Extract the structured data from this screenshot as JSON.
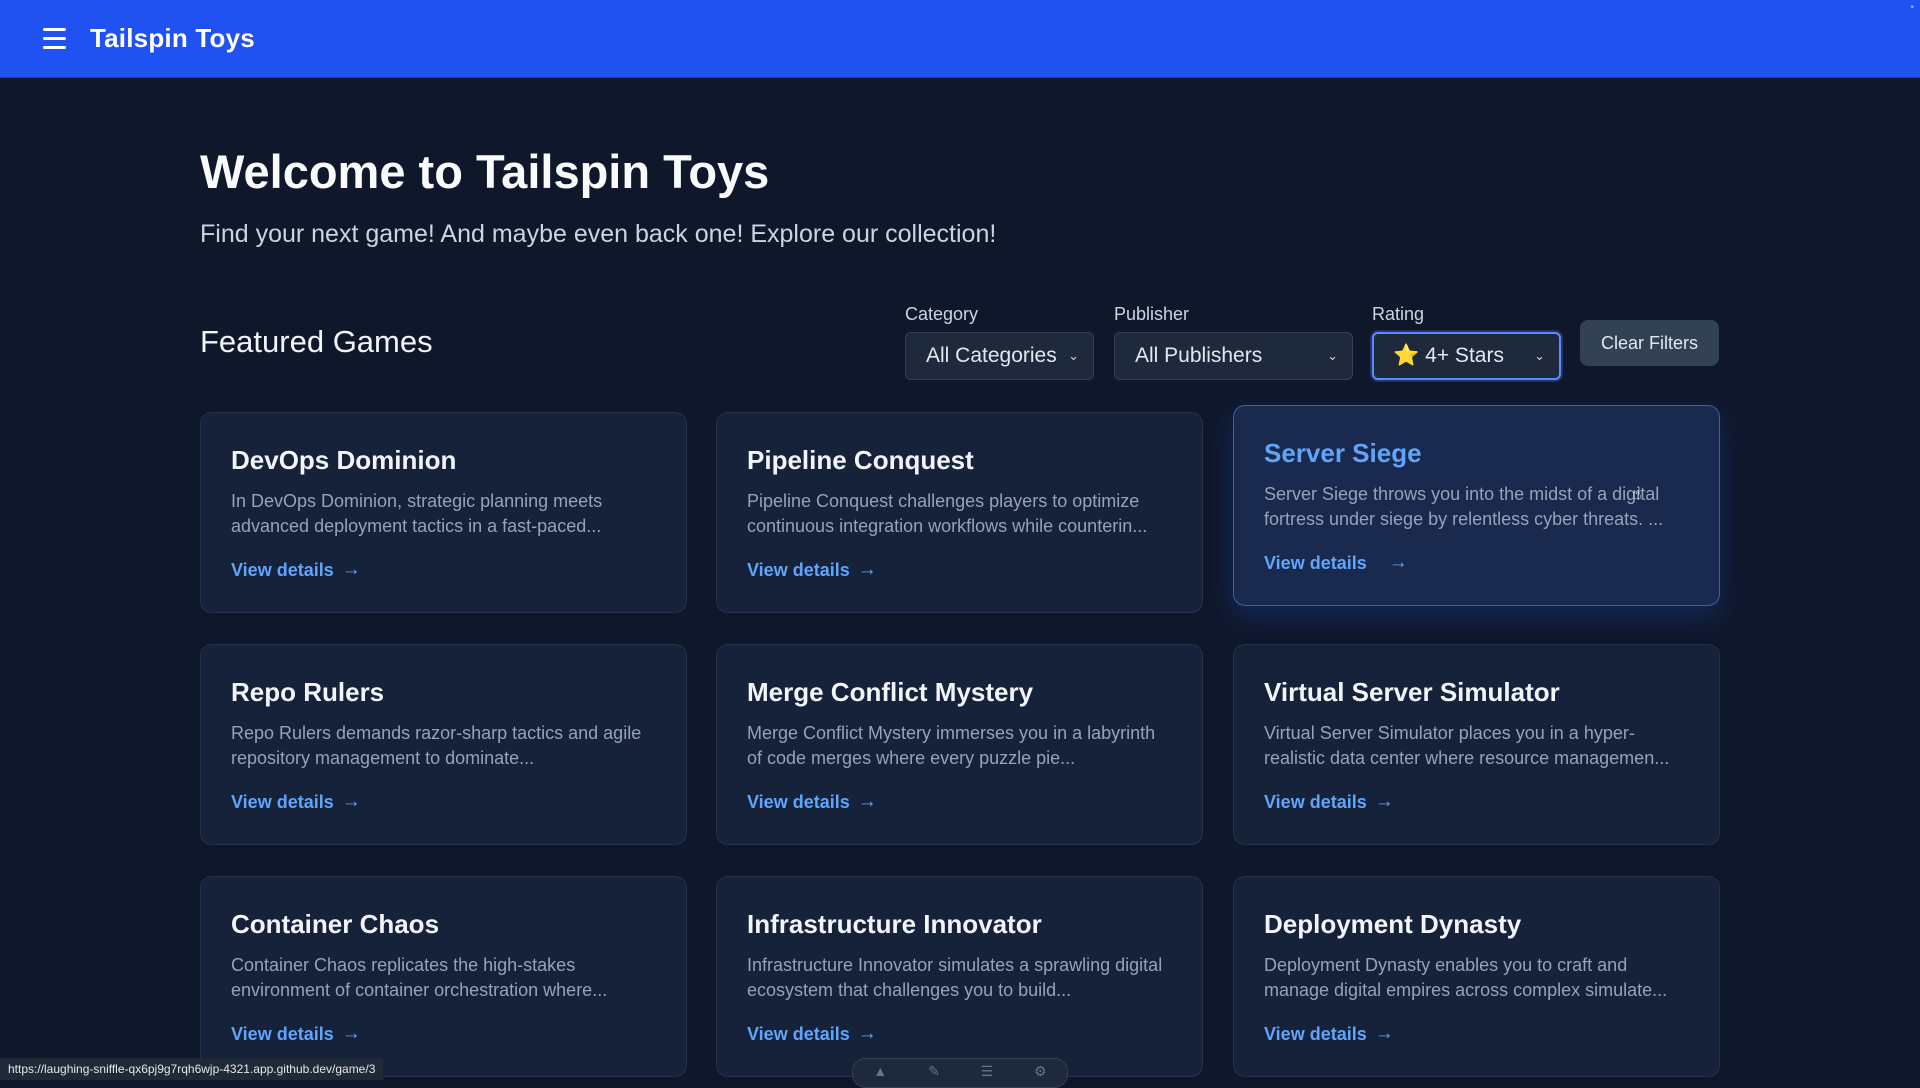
{
  "header": {
    "brand": "Tailspin Toys"
  },
  "hero": {
    "title": "Welcome to Tailspin Toys",
    "subtitle": "Find your next game! And maybe even back one! Explore our collection!"
  },
  "featured": {
    "title": "Featured Games"
  },
  "filters": {
    "category": {
      "label": "Category",
      "value": "All Categories"
    },
    "publisher": {
      "label": "Publisher",
      "value": "All Publishers"
    },
    "rating": {
      "label": "Rating",
      "star": "⭐",
      "value": "4+ Stars"
    },
    "clear_label": "Clear Filters"
  },
  "games": [
    {
      "title": "DevOps Dominion",
      "description": "In DevOps Dominion, strategic planning meets advanced deployment tactics in a fast-paced...",
      "link": "View details"
    },
    {
      "title": "Pipeline Conquest",
      "description": "Pipeline Conquest challenges players to optimize continuous integration workflows while counterin...",
      "link": "View details"
    },
    {
      "title": "Server Siege",
      "description": "Server Siege throws you into the midst of a digital fortress under siege by relentless cyber threats. ...",
      "link": "View details"
    },
    {
      "title": "Repo Rulers",
      "description": "Repo Rulers demands razor-sharp tactics and agile repository management to dominate...",
      "link": "View details"
    },
    {
      "title": "Merge Conflict Mystery",
      "description": "Merge Conflict Mystery immerses you in a labyrinth of code merges where every puzzle pie...",
      "link": "View details"
    },
    {
      "title": "Virtual Server Simulator",
      "description": "Virtual Server Simulator places you in a hyper-realistic data center where resource managemen...",
      "link": "View details"
    },
    {
      "title": "Container Chaos",
      "description": "Container Chaos replicates the high-stakes environment of container orchestration where...",
      "link": "View details"
    },
    {
      "title": "Infrastructure Innovator",
      "description": "Infrastructure Innovator simulates a sprawling digital ecosystem that challenges you to build...",
      "link": "View details"
    },
    {
      "title": "Deployment Dynasty",
      "description": "Deployment Dynasty enables you to craft and manage digital empires across complex simulate...",
      "link": "View details"
    }
  ],
  "icons": {
    "arrow": "→",
    "chevron": "⌄"
  },
  "statusbar": {
    "url": "https://laughing-sniffle-qx6pj9g7rqh6wjp-4321.app.github.dev/game/3"
  },
  "colors": {
    "header_bg": "#2052f2",
    "page_bg": "#0f172a",
    "card_bg": "#16213a",
    "link": "#60a5fa",
    "accent_border": "#5b8cff"
  }
}
